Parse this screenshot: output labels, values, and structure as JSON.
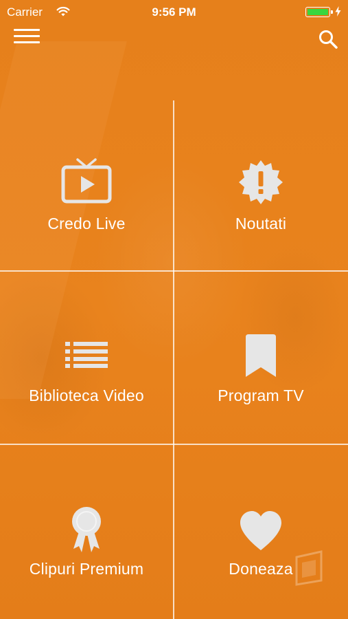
{
  "status_bar": {
    "carrier": "Carrier",
    "time": "9:56 PM",
    "battery_color": "#39d63e"
  },
  "header": {
    "menu_icon": "hamburger-menu-icon",
    "search_icon": "search-icon"
  },
  "theme": {
    "accent": "#e8811c",
    "divider": "#ffffff",
    "text": "#ffffff",
    "icon": "#e6e6e6"
  },
  "tiles": [
    {
      "label": "Credo Live",
      "icon": "tv-play-icon"
    },
    {
      "label": "Noutati",
      "icon": "alert-badge-icon"
    },
    {
      "label": "Biblioteca Video",
      "icon": "list-icon"
    },
    {
      "label": "Program TV",
      "icon": "bookmark-icon"
    },
    {
      "label": "Clipuri Premium",
      "icon": "award-ribbon-icon"
    },
    {
      "label": "Doneaza",
      "icon": "heart-icon"
    }
  ]
}
